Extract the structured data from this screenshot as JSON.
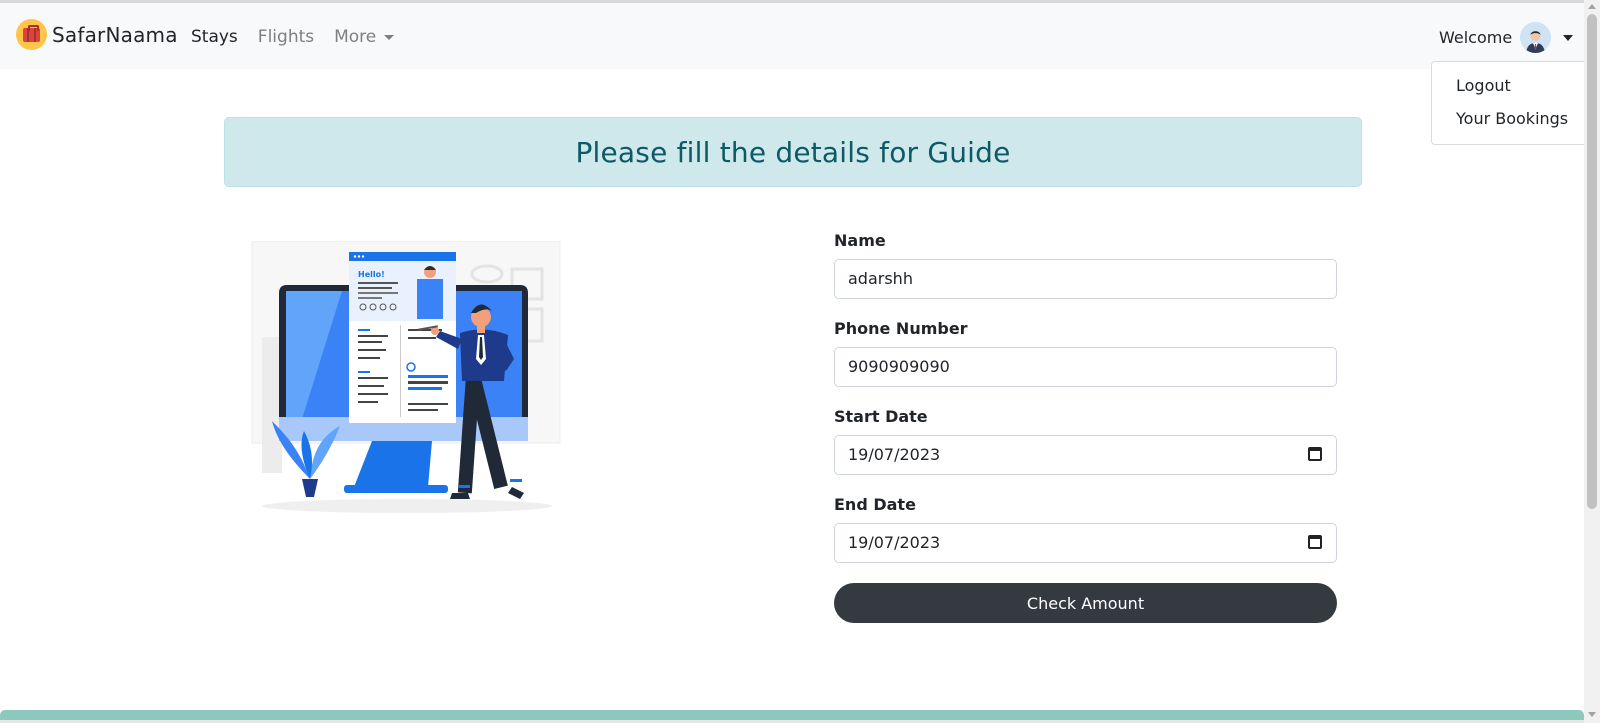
{
  "brand": {
    "name": "SafarNaama",
    "logo_icon": "suitcase-icon"
  },
  "nav": {
    "items": [
      {
        "label": "Stays"
      },
      {
        "label": "Flights"
      },
      {
        "label": "More"
      }
    ]
  },
  "user_menu": {
    "welcome": "Welcome",
    "items": [
      {
        "label": "Logout"
      },
      {
        "label": "Your Bookings"
      }
    ]
  },
  "banner": {
    "title": "Please fill the details for Guide"
  },
  "illustration": {
    "greeting": "Hello!"
  },
  "form": {
    "name": {
      "label": "Name",
      "value": "adarshh"
    },
    "phone": {
      "label": "Phone Number",
      "value": "9090909090"
    },
    "start_date": {
      "label": "Start Date",
      "value": "19/07/2023"
    },
    "end_date": {
      "label": "End Date",
      "value": "19/07/2023"
    },
    "submit_label": "Check Amount"
  },
  "colors": {
    "navbar_bg": "#f8f9fa",
    "alert_bg": "#cfe8ec",
    "alert_text": "#0d5966",
    "button_bg": "#343a40",
    "footer_bar": "#8cc8bd",
    "accent_blue": "#1a73e8"
  }
}
